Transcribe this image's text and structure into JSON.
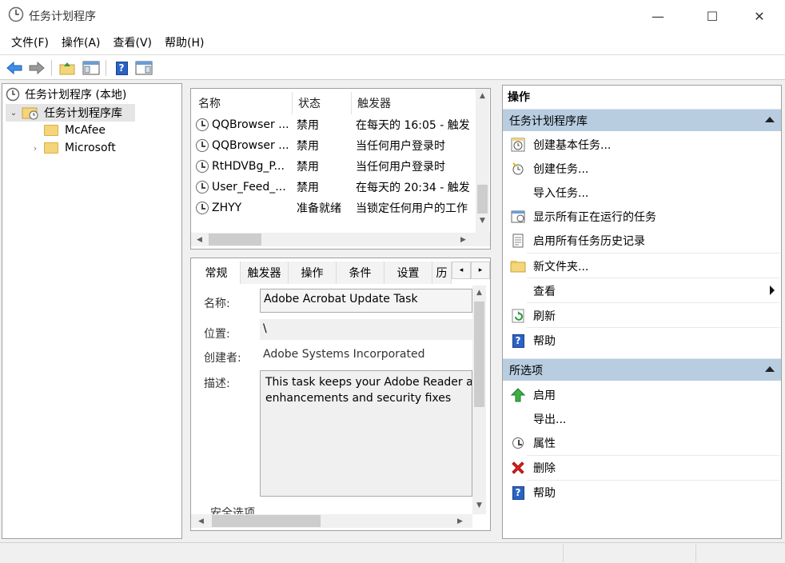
{
  "window": {
    "title": "任务计划程序",
    "minimize": "—",
    "maximize": "☐",
    "close": "✕"
  },
  "menu": [
    "文件(F)",
    "操作(A)",
    "查看(V)",
    "帮助(H)"
  ],
  "tree": {
    "root": "任务计划程序 (本地)",
    "library": "任务计划程序库",
    "children": [
      "McAfee",
      "Microsoft"
    ]
  },
  "task_list": {
    "columns": [
      "名称",
      "状态",
      "触发器"
    ],
    "rows": [
      {
        "name": "QQBrowser ...",
        "status": "禁用",
        "trigger": "在每天的 16:05 - 触发"
      },
      {
        "name": "QQBrowser ...",
        "status": "禁用",
        "trigger": "当任何用户登录时"
      },
      {
        "name": "RtHDVBg_P...",
        "status": "禁用",
        "trigger": "当任何用户登录时"
      },
      {
        "name": "User_Feed_...",
        "status": "禁用",
        "trigger": "在每天的 20:34 - 触发"
      },
      {
        "name": "ZHYY",
        "status": "准备就绪",
        "trigger": "当锁定任何用户的工作"
      }
    ]
  },
  "details": {
    "tabs": [
      "常规",
      "触发器",
      "操作",
      "条件",
      "设置",
      "历"
    ],
    "name_label": "名称:",
    "name_value": "Adobe Acrobat Update Task",
    "location_label": "位置:",
    "location_value": "\\",
    "author_label": "创建者:",
    "author_value": "Adobe Systems Incorporated",
    "desc_label": "描述:",
    "desc_line1": "This task keeps your Adobe Reader an",
    "desc_line2": "enhancements and security fixes",
    "security_label": "安全选项"
  },
  "actions": {
    "header": "操作",
    "section1": "任务计划程序库",
    "items1": [
      "创建基本任务...",
      "创建任务...",
      "导入任务...",
      "显示所有正在运行的任务",
      "启用所有任务历史记录",
      "新文件夹...",
      "查看",
      "刷新",
      "帮助"
    ],
    "section2": "所选项",
    "items2": [
      "启用",
      "导出...",
      "属性",
      "删除",
      "帮助"
    ]
  }
}
